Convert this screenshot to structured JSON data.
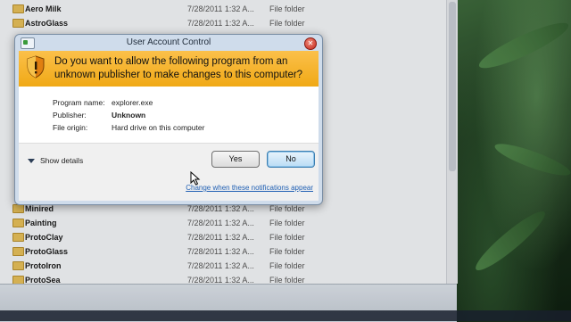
{
  "explorer": {
    "rows_top": [
      {
        "name": "Aero Milk",
        "date": "7/28/2011 1:32 A...",
        "type": "File folder"
      },
      {
        "name": "AstroGlass",
        "date": "7/28/2011 1:32 A...",
        "type": "File folder"
      }
    ],
    "rows_bottom": [
      {
        "name": "Minired",
        "date": "7/28/2011 1:32 A...",
        "type": "File folder"
      },
      {
        "name": "Painting",
        "date": "7/28/2011 1:32 A...",
        "type": "File folder"
      },
      {
        "name": "ProtoClay",
        "date": "7/28/2011 1:32 A...",
        "type": "File folder"
      },
      {
        "name": "ProtoGlass",
        "date": "7/28/2011 1:32 A...",
        "type": "File folder"
      },
      {
        "name": "ProtoIron",
        "date": "7/28/2011 1:32 A...",
        "type": "File folder"
      },
      {
        "name": "ProtoSea",
        "date": "7/28/2011 1:32 A...",
        "type": "File folder"
      }
    ]
  },
  "uac": {
    "title": "User Account Control",
    "question": "Do you want to allow the following program from an unknown publisher to make changes to this computer?",
    "program_name_label": "Program name:",
    "program_name_value": "explorer.exe",
    "publisher_label": "Publisher:",
    "publisher_value": "Unknown",
    "file_origin_label": "File origin:",
    "file_origin_value": "Hard drive on this computer",
    "show_details": "Show details",
    "yes_label": "Yes",
    "no_label": "No",
    "change_link": "Change when these notifications appear",
    "icons": {
      "shield": "shield-warning-icon",
      "close": "close-icon",
      "chevron": "chevron-down-icon"
    }
  },
  "colors": {
    "banner": "#f0a916",
    "link": "#1f5fb3",
    "default_button": "#b9dcf5"
  }
}
